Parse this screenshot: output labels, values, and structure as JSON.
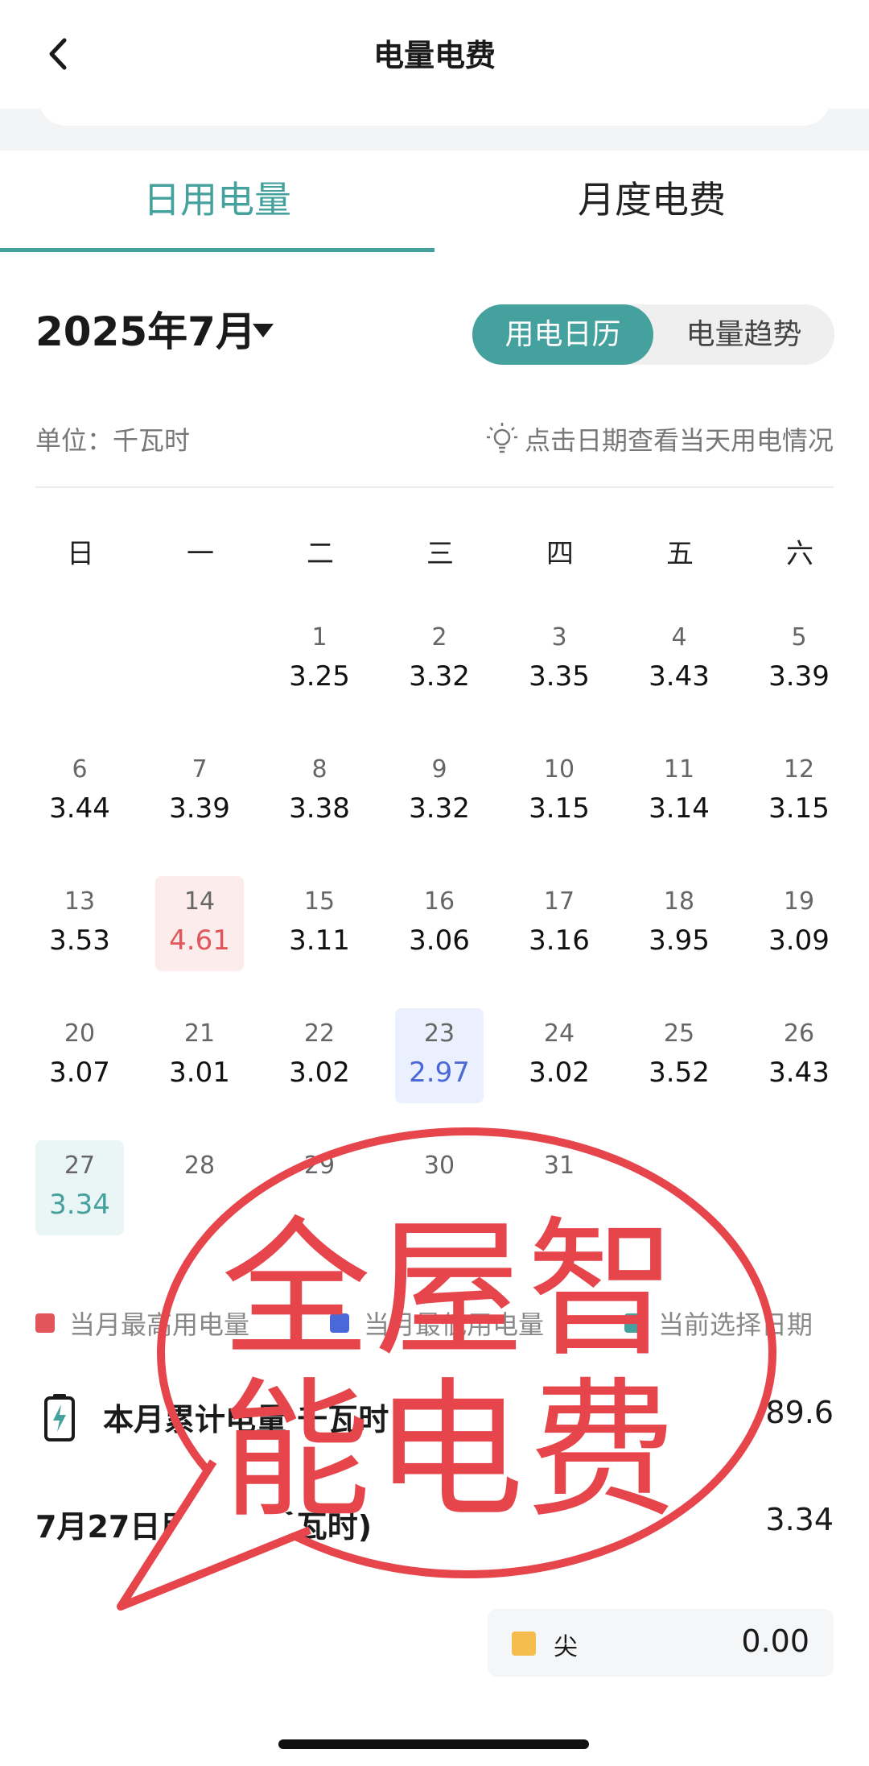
{
  "header": {
    "title": "电量电费"
  },
  "tabs": [
    {
      "label": "日用电量",
      "active": true
    },
    {
      "label": "月度电费",
      "active": false
    }
  ],
  "month_label": "2025年7月",
  "view_toggle": {
    "options": [
      "用电日历",
      "电量趋势"
    ],
    "selected": "用电日历"
  },
  "unit_label": "单位：千瓦时",
  "hint": "点击日期查看当天用电情况",
  "weekdays": [
    "日",
    "一",
    "二",
    "三",
    "四",
    "五",
    "六"
  ],
  "days": [
    {
      "day": "1",
      "value": "3.25"
    },
    {
      "day": "2",
      "value": "3.32"
    },
    {
      "day": "3",
      "value": "3.35"
    },
    {
      "day": "4",
      "value": "3.43"
    },
    {
      "day": "5",
      "value": "3.39"
    },
    {
      "day": "6",
      "value": "3.44"
    },
    {
      "day": "7",
      "value": "3.39"
    },
    {
      "day": "8",
      "value": "3.38"
    },
    {
      "day": "9",
      "value": "3.32"
    },
    {
      "day": "10",
      "value": "3.15"
    },
    {
      "day": "11",
      "value": "3.14"
    },
    {
      "day": "12",
      "value": "3.15"
    },
    {
      "day": "13",
      "value": "3.53"
    },
    {
      "day": "14",
      "value": "4.61",
      "mark": "max"
    },
    {
      "day": "15",
      "value": "3.11"
    },
    {
      "day": "16",
      "value": "3.06"
    },
    {
      "day": "17",
      "value": "3.16"
    },
    {
      "day": "18",
      "value": "3.95"
    },
    {
      "day": "19",
      "value": "3.09"
    },
    {
      "day": "20",
      "value": "3.07"
    },
    {
      "day": "21",
      "value": "3.01"
    },
    {
      "day": "22",
      "value": "3.02"
    },
    {
      "day": "23",
      "value": "2.97",
      "mark": "min"
    },
    {
      "day": "24",
      "value": "3.02"
    },
    {
      "day": "25",
      "value": "3.52"
    },
    {
      "day": "26",
      "value": "3.43"
    },
    {
      "day": "27",
      "value": "3.34",
      "mark": "sel"
    },
    {
      "day": "28",
      "value": ""
    },
    {
      "day": "29",
      "value": ""
    },
    {
      "day": "30",
      "value": ""
    },
    {
      "day": "31",
      "value": ""
    }
  ],
  "legend": [
    {
      "label": "当月最高用电量",
      "color": "#e2555a"
    },
    {
      "label": "当月最低用电量",
      "color": "#4b68d8"
    },
    {
      "label": "当前选择日期",
      "color": "#45a19d"
    }
  ],
  "summary": {
    "month_total_label": "本月累计电量 千瓦时",
    "month_total_value": "89.6",
    "day_label": "7月27日用电量(千瓦时)",
    "day_value": "3.34"
  },
  "peak": {
    "label": "尖",
    "value": "0.00",
    "color": "#f5bd4d"
  },
  "watermark": {
    "line1": "全屋智",
    "line2": "能电费",
    "color": "#e6454b"
  }
}
